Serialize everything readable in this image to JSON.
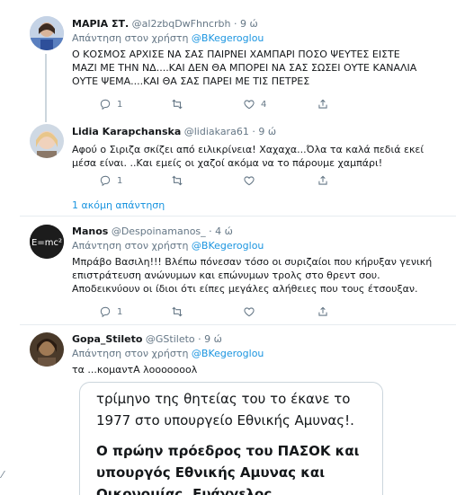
{
  "tweets": [
    {
      "name": "ΜΑΡΙΑ ΣΤ.",
      "handle": "@al2zbqDwFhncrbh",
      "time": "9 ώ",
      "reply_prefix": "Απάντηση στον χρήστη",
      "reply_handle": "@BKegeroglou",
      "text": "Ο ΚΟΣΜΟΣ ΑΡΧΙΣΕ ΝΑ ΣΑΣ ΠΑΙΡΝΕΙ ΧΑΜΠΑΡΙ ΠΟΣΟ ΨΕΥΤΕΣ ΕΙΣΤΕ ΜΑΖΙ ΜΕ ΤΗΝ ΝΔ....ΚΑΙ ΔΕΝ ΘΑ ΜΠΟΡΕΙ ΝΑ ΣΑΣ ΣΩΣΕΙ ΟΥΤΕ ΚΑΝΑΛΙΑ ΟΥΤΕ ΨΕΜΑ....ΚΑΙ ΘΑ ΣΑΣ ΠΑΡΕΙ ΜΕ ΤΙΣ ΠΕΤΡΕΣ",
      "replies": "1",
      "retweets": "",
      "likes": "4"
    },
    {
      "name": "Lidia Karapchanska",
      "handle": "@lidiakara61",
      "time": "9 ώ",
      "text": "Αφού ο Σιριζα σκίζει από ειλικρίνεια! Χαχαχα...Όλα τα καλά πεδιά εκεί μέσα είναι. ..Και εμείς οι χαζοί ακόμα να το πάρουμε χαμπάρι!",
      "replies": "1",
      "retweets": "",
      "likes": ""
    },
    {
      "name": "Manos",
      "handle": "@Despoinamanos_",
      "time": "4 ώ",
      "reply_prefix": "Απάντηση στον χρήστη",
      "reply_handle": "@BKegeroglou",
      "text": "Μπράβο Βασιλη!!! Βλέπω πόνεσαν τόσο οι συριζαίοι που κήρυξαν γενική επιστράτευση ανώνυμων και επώνυμων τρολς στο θρεντ σου. Αποδεικνύουν οι ίδιοι ότι είπες μεγάλες αλήθειες που τους έτσουξαν.",
      "avatar_text": "E=mc²",
      "replies": "1",
      "retweets": "",
      "likes": ""
    },
    {
      "name": "Gopa_Stileto",
      "handle": "@GStileto",
      "time": "9 ώ",
      "reply_prefix": "Απάντηση στον χρήστη",
      "reply_handle": "@BKegeroglou",
      "text": "τα ...κομαντΑ λοοοοοοολ"
    }
  ],
  "more_replies": "1 ακόμη απάντηση",
  "quote": {
    "line1": "τρίμηνο της θητείας του το έκανε το 1977 στο υπουργείο Εθνικής Αμυνας!.",
    "line2": "Ο πρώην πρόεδρος του ΠΑΣΟΚ και υπουργός Εθνικής Αμυνας και Οικονομίας, Ευάγγελος"
  },
  "icons": [
    "reply-icon",
    "retweet-icon",
    "like-icon",
    "share-icon"
  ],
  "colors": {
    "link": "#1b95e0",
    "muted": "#657786",
    "border": "#e6ecf0"
  }
}
